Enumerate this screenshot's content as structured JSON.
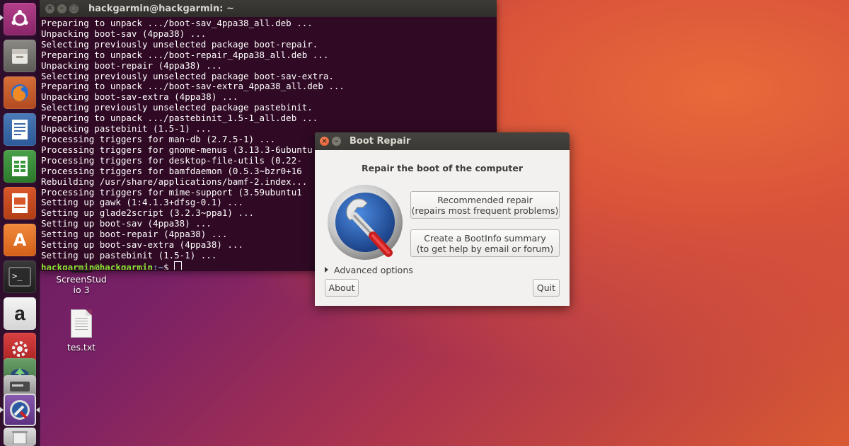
{
  "terminal": {
    "title": "hackgarmin@hackgarmin: ~",
    "lines": [
      "Preparing to unpack .../boot-sav_4ppa38_all.deb ...",
      "Unpacking boot-sav (4ppa38) ...",
      "Selecting previously unselected package boot-repair.",
      "Preparing to unpack .../boot-repair_4ppa38_all.deb ...",
      "Unpacking boot-repair (4ppa38) ...",
      "Selecting previously unselected package boot-sav-extra.",
      "Preparing to unpack .../boot-sav-extra_4ppa38_all.deb ...",
      "Unpacking boot-sav-extra (4ppa38) ...",
      "Selecting previously unselected package pastebinit.",
      "Preparing to unpack .../pastebinit_1.5-1_all.deb ...",
      "Unpacking pastebinit (1.5-1) ...",
      "Processing triggers for man-db (2.7.5-1) ...",
      "Processing triggers for gnome-menus (3.13.3-6ubuntu",
      "Processing triggers for desktop-file-utils (0.22-",
      "Processing triggers for bamfdaemon (0.5.3~bzr0+16",
      "Rebuilding /usr/share/applications/bamf-2.index...",
      "Processing triggers for mime-support (3.59ubuntu1",
      "Setting up gawk (1:4.1.3+dfsg-0.1) ...",
      "Setting up glade2script (3.2.3~ppa1) ...",
      "Setting up boot-sav (4ppa38) ...",
      "Setting up boot-repair (4ppa38) ...",
      "Setting up boot-sav-extra (4ppa38) ...",
      "Setting up pastebinit (1.5-1) ..."
    ],
    "prompt_user": "hackgarmin@hackgarmin",
    "prompt_path": ":~",
    "prompt_symbol": "$ "
  },
  "desktop": {
    "icons": [
      {
        "label": "ScreenStudio 3"
      },
      {
        "label": "tes.txt"
      }
    ]
  },
  "launcher": {
    "items": [
      {
        "name": "ubuntu-dash-icon"
      },
      {
        "name": "files-icon"
      },
      {
        "name": "firefox-icon"
      },
      {
        "name": "libreoffice-writer-icon"
      },
      {
        "name": "libreoffice-calc-icon"
      },
      {
        "name": "libreoffice-impress-icon"
      },
      {
        "name": "software-center-icon"
      },
      {
        "name": "terminal-icon"
      },
      {
        "name": "amazon-icon"
      },
      {
        "name": "system-settings-icon"
      },
      {
        "name": "software-updater-icon"
      },
      {
        "name": "disk-drive-icon"
      },
      {
        "name": "boot-repair-icon"
      },
      {
        "name": "trash-icon"
      }
    ]
  },
  "dialog": {
    "title": "Boot Repair",
    "heading": "Repair the boot of the computer",
    "recommended_line1": "Recommended repair",
    "recommended_line2": "(repairs most frequent problems)",
    "bootinfo_line1": "Create a BootInfo summary",
    "bootinfo_line2": "(to get help by email or forum)",
    "advanced_label": "Advanced options",
    "about_label": "About",
    "quit_label": "Quit"
  },
  "colors": {
    "terminal_bg": "#300a24",
    "prompt_green": "#8ae234",
    "prompt_blue": "#729fcf",
    "close_orange": "#e0552a"
  }
}
